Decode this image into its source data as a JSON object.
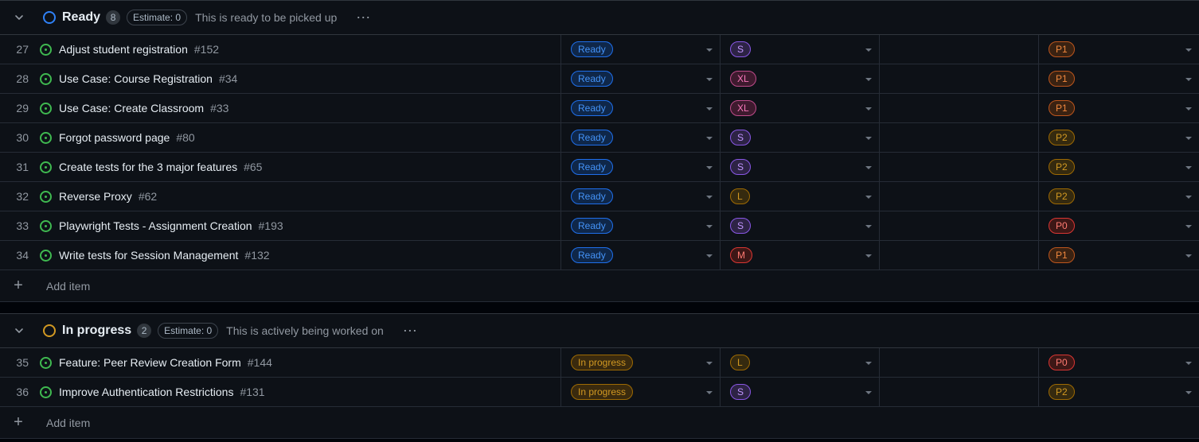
{
  "groups": [
    {
      "title": "Ready",
      "count": "8",
      "estimate": "Estimate: 0",
      "description": "This is ready to be picked up",
      "status_color": "#2f81f7",
      "add_item_label": "Add item",
      "rows": [
        {
          "n": "27",
          "title": "Adjust student registration",
          "issue": "#152",
          "status": "Ready",
          "size": "S",
          "priority": "P1"
        },
        {
          "n": "28",
          "title": "Use Case: Course Registration",
          "issue": "#34",
          "status": "Ready",
          "size": "XL",
          "priority": "P1"
        },
        {
          "n": "29",
          "title": "Use Case: Create Classroom",
          "issue": "#33",
          "status": "Ready",
          "size": "XL",
          "priority": "P1"
        },
        {
          "n": "30",
          "title": "Forgot password page",
          "issue": "#80",
          "status": "Ready",
          "size": "S",
          "priority": "P2"
        },
        {
          "n": "31",
          "title": "Create tests for the 3 major features",
          "issue": "#65",
          "status": "Ready",
          "size": "S",
          "priority": "P2"
        },
        {
          "n": "32",
          "title": "Reverse Proxy",
          "issue": "#62",
          "status": "Ready",
          "size": "L",
          "priority": "P2"
        },
        {
          "n": "33",
          "title": "Playwright Tests - Assignment Creation",
          "issue": "#193",
          "status": "Ready",
          "size": "S",
          "priority": "P0"
        },
        {
          "n": "34",
          "title": "Write tests for Session Management",
          "issue": "#132",
          "status": "Ready",
          "size": "M",
          "priority": "P1"
        }
      ]
    },
    {
      "title": "In progress",
      "count": "2",
      "estimate": "Estimate: 0",
      "description": "This is actively being worked on",
      "status_color": "#d29922",
      "add_item_label": "Add item",
      "rows": [
        {
          "n": "35",
          "title": "Feature: Peer Review Creation Form",
          "issue": "#144",
          "status": "In progress",
          "size": "L",
          "priority": "P0"
        },
        {
          "n": "36",
          "title": "Improve Authentication Restrictions",
          "issue": "#131",
          "status": "In progress",
          "size": "S",
          "priority": "P2"
        }
      ]
    }
  ],
  "colors": {
    "status": {
      "Ready": {
        "fg": "#4493f8",
        "bg": "#0f2749",
        "border": "#1f6feb"
      },
      "In progress": {
        "fg": "#d29922",
        "bg": "#3a2a0e",
        "border": "#9e6a03"
      }
    },
    "size": {
      "S": {
        "fg": "#c297ff",
        "bg": "#2d2345",
        "border": "#8957e5"
      },
      "M": {
        "fg": "#ff7b72",
        "bg": "#3d1716",
        "border": "#da3633"
      },
      "L": {
        "fg": "#d29922",
        "bg": "#352a0f",
        "border": "#9e6a03"
      },
      "XL": {
        "fg": "#f778ba",
        "bg": "#3e1a2e",
        "border": "#bf4b8a"
      }
    },
    "priority": {
      "P0": {
        "fg": "#ff7b72",
        "bg": "#3d1716",
        "border": "#da3633"
      },
      "P1": {
        "fg": "#f0883e",
        "bg": "#3a2212",
        "border": "#bd561d"
      },
      "P2": {
        "fg": "#d29922",
        "bg": "#352a0f",
        "border": "#9e6a03"
      }
    }
  }
}
